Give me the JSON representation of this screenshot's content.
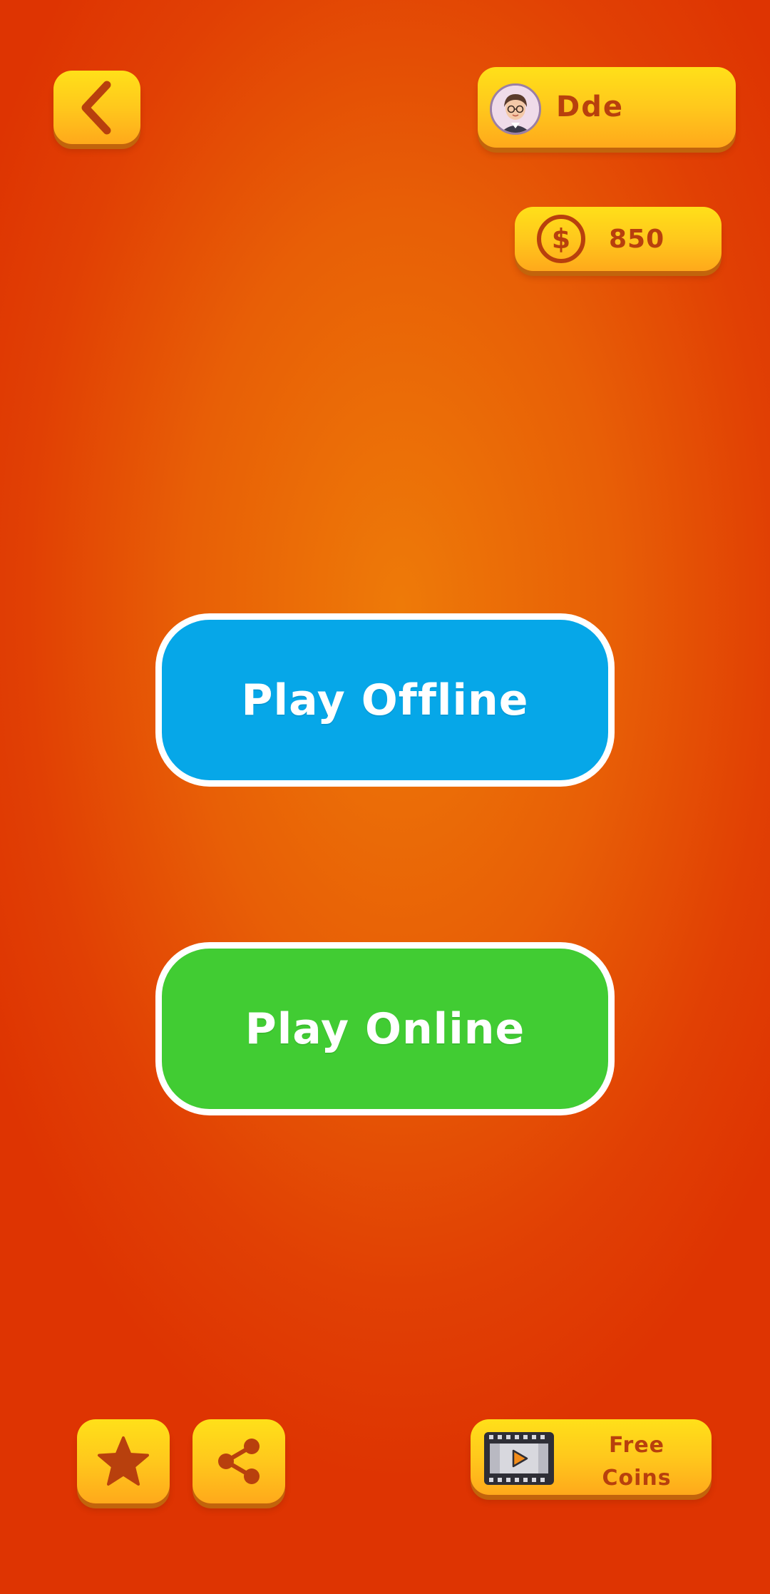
{
  "header": {
    "back_icon": "chevron-left-icon",
    "profile": {
      "avatar": "avatar-girl-glasses",
      "username": "Dde"
    },
    "coins": {
      "icon": "dollar-coin-icon",
      "count": "850"
    }
  },
  "main": {
    "play_offline_label": "Play Offline",
    "play_online_label": "Play Online"
  },
  "footer": {
    "rate_icon": "star-icon",
    "share_icon": "share-icon",
    "free_coins": {
      "icon": "video-film-icon",
      "line1": "Free",
      "line2": "Coins"
    }
  },
  "colors": {
    "background": "#e85f06",
    "panel_yellow": "#ffc81c",
    "panel_text": "#b8400d",
    "play_offline": "#06a7e8",
    "play_online": "#41cc33"
  }
}
